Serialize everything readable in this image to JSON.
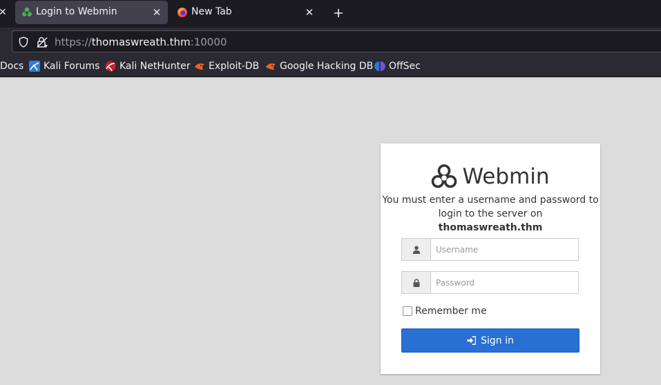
{
  "tabs": [
    {
      "title": "Login to Webmin",
      "active": true,
      "icon": "webmin-icon"
    },
    {
      "title": "New Tab",
      "active": false,
      "icon": "firefox-icon"
    }
  ],
  "address_bar": {
    "scheme": "https://",
    "host": "thomaswreath.thm",
    "port": ":10000"
  },
  "bookmarks": [
    {
      "label": "Docs",
      "icon": null
    },
    {
      "label": "Kali Forums",
      "icon": "kali-forums-icon"
    },
    {
      "label": "Kali NetHunter",
      "icon": "kali-nethunter-icon"
    },
    {
      "label": "Exploit-DB",
      "icon": "exploit-db-icon"
    },
    {
      "label": "Google Hacking DB",
      "icon": "ghdb-icon"
    },
    {
      "label": "OffSec",
      "icon": "offsec-icon"
    }
  ],
  "login": {
    "brand": "Webmin",
    "message": "You must enter a username and password to login to the server on",
    "server": "thomaswreath.thm",
    "username_placeholder": "Username",
    "password_placeholder": "Password",
    "remember_label": "Remember me",
    "remember_checked": false,
    "signin_label": "Sign in"
  },
  "colors": {
    "primary_button": "#2a6fd4",
    "page_background": "#dcdcdc",
    "browser_chrome": "#2b2a33"
  }
}
